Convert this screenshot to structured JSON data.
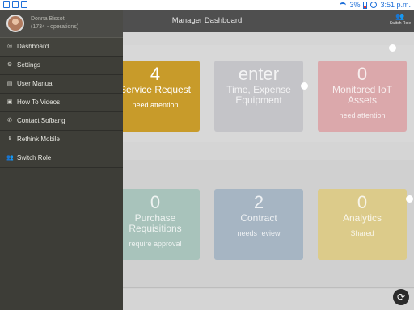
{
  "statusbar": {
    "battery": "3%",
    "time": "3:51 p.m."
  },
  "appbar": {
    "title": "Manager Dashboard",
    "switch_label": "Switch Role"
  },
  "drawer": {
    "user_name": "Donna Bissot",
    "user_role": "(1734 - operations)",
    "items": [
      {
        "label": "Dashboard",
        "icon": "gauge-icon",
        "glyph": "◎"
      },
      {
        "label": "Settings",
        "icon": "gear-icon",
        "glyph": "⚙"
      },
      {
        "label": "User Manual",
        "icon": "book-icon",
        "glyph": "▤"
      },
      {
        "label": "How To Videos",
        "icon": "video-icon",
        "glyph": "▣"
      },
      {
        "label": "Contact Sofbang",
        "icon": "phone-icon",
        "glyph": "✆"
      },
      {
        "label": "Rethink Mobile",
        "icon": "info-icon",
        "glyph": "ℹ"
      },
      {
        "label": "Switch Role",
        "icon": "users-icon",
        "glyph": "👥"
      }
    ]
  },
  "tiles": [
    {
      "num": "4",
      "name": "Service Request",
      "sub": "need attention",
      "color": "#c89b2a"
    },
    {
      "num": "enter",
      "name": "Time, Expense Equipment",
      "sub": "",
      "color": "#c4c4c8"
    },
    {
      "num": "0",
      "name": "Monitored IoT Assets",
      "sub": "need attention",
      "color": "#dba8ab"
    },
    {
      "num": "0",
      "name": "Purchase Requisitions",
      "sub": "require approval",
      "color": "#a8c3bb"
    },
    {
      "num": "2",
      "name": "Contract",
      "sub": "needs review",
      "color": "#a6b5c3"
    },
    {
      "num": "0",
      "name": "Analytics",
      "sub": "Shared",
      "color": "#dccb8a"
    }
  ]
}
